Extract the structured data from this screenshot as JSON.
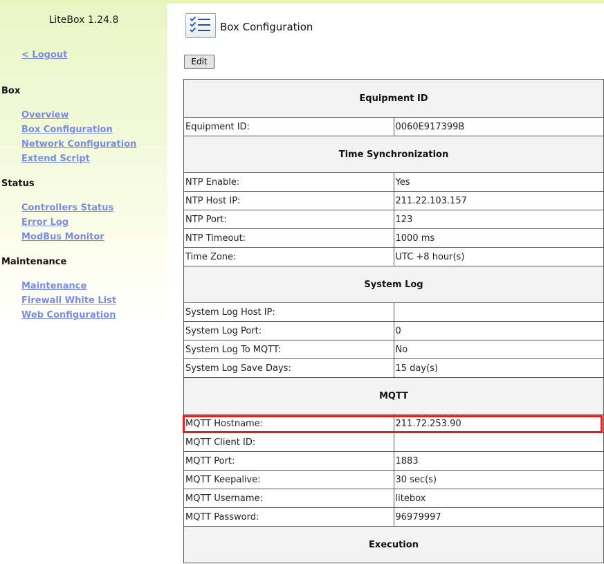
{
  "app_title": "LiteBox 1.24.8",
  "logout_label": "< Logout",
  "sidebar": {
    "sections": [
      {
        "title": "Box",
        "items": [
          "Overview",
          "Box Configuration",
          "Network Configuration",
          "Extend Script"
        ]
      },
      {
        "title": "Status",
        "items": [
          "Controllers Status",
          "Error Log",
          "ModBus Monitor"
        ]
      },
      {
        "title": "Maintenance",
        "items": [
          "Maintenance",
          "Firewall White List",
          "Web Configuration"
        ]
      }
    ]
  },
  "page_title": "Box Configuration",
  "edit_label": "Edit",
  "config": {
    "equipment": {
      "header": "Equipment ID",
      "rows": [
        [
          "Equipment ID:",
          "0060E917399B"
        ]
      ]
    },
    "time": {
      "header": "Time Synchronization",
      "rows": [
        [
          "NTP Enable:",
          "Yes"
        ],
        [
          "NTP Host IP:",
          "211.22.103.157"
        ],
        [
          "NTP Port:",
          "123"
        ],
        [
          "NTP Timeout:",
          "1000 ms"
        ],
        [
          "Time Zone:",
          "UTC +8 hour(s)"
        ]
      ]
    },
    "syslog": {
      "header": "System Log",
      "rows": [
        [
          "System Log Host IP:",
          ""
        ],
        [
          "System Log Port:",
          "0"
        ],
        [
          "System Log To MQTT:",
          "No"
        ],
        [
          "System Log Save Days:",
          "15 day(s)"
        ]
      ]
    },
    "mqtt": {
      "header": "MQTT",
      "rows": [
        [
          "MQTT Hostname:",
          "211.72.253.90"
        ],
        [
          "MQTT Client ID:",
          ""
        ],
        [
          "MQTT Port:",
          "1883"
        ],
        [
          "MQTT Keepalive:",
          "30 sec(s)"
        ],
        [
          "MQTT Username:",
          "litebox"
        ],
        [
          "MQTT Password:",
          "96979997"
        ]
      ]
    },
    "execution": {
      "header": "Execution"
    }
  },
  "highlight_color": "#dd1f1f",
  "link_color": "#7a8ce0",
  "page_icon": "checklist-icon"
}
